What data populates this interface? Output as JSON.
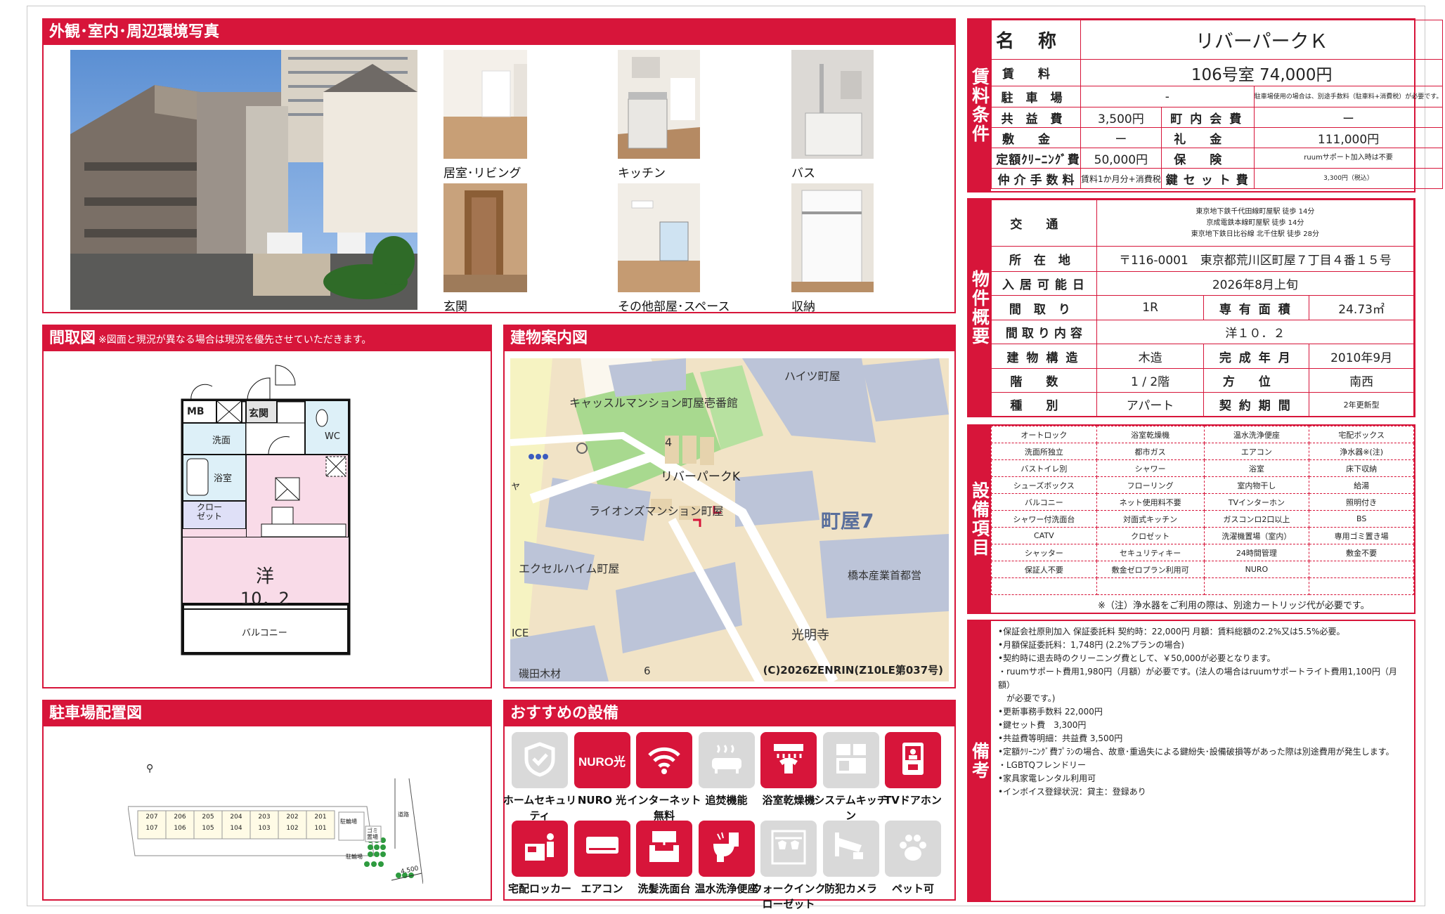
{
  "photos": {
    "title": "外観･室内･周辺環境写真",
    "captions": [
      "居室･リビング",
      "キッチン",
      "バス",
      "玄関",
      "その他部屋･スペース",
      "収納"
    ]
  },
  "floorplan": {
    "title": "間取図",
    "note": "※図面と現況が異なる場合は現況を優先させていただきます。",
    "rooms": {
      "mb": "MB",
      "entrance": "玄関",
      "wash": "洗面",
      "wc": "WC",
      "bath": "浴室",
      "closet": "クロー\nゼット",
      "main": "洋",
      "main_size": "10．2",
      "balcony": "バルコニー"
    }
  },
  "map": {
    "title": "建物案内図",
    "labels": [
      "ハイツ町屋",
      "キャッスルマンション町屋壱番館",
      "4",
      "リバーパークK",
      "ライオンズマンション町屋",
      "町屋7",
      "エクセルハイム町屋",
      "橋本産業首都営",
      "光明寺",
      "ICE",
      "磯田木材",
      "6",
      "ャ"
    ],
    "copyright": "(C)2026ZENRIN(Z10LE第037号)"
  },
  "parking": {
    "title": "駐車場配置図",
    "units_top": [
      "207",
      "206",
      "205",
      "204",
      "203",
      "202",
      "201"
    ],
    "units_bottom": [
      "107",
      "106",
      "105",
      "104",
      "103",
      "102",
      "101"
    ],
    "bike": "駐輪場",
    "bike2": "駐輪場",
    "trash": "ゴミ\n置場",
    "road": "道路",
    "width": "4.500"
  },
  "recommended": {
    "title": "おすすめの設備",
    "items": [
      {
        "label": "ホームセキュリティ",
        "on": false,
        "icon": "shield-icon"
      },
      {
        "label": "NURO 光",
        "on": true,
        "icon": "nuro-icon",
        "glyph": "NURO光"
      },
      {
        "label": "インターネット無料",
        "on": true,
        "icon": "wifi-icon"
      },
      {
        "label": "追焚機能",
        "on": false,
        "icon": "bathtub-icon"
      },
      {
        "label": "浴室乾燥機",
        "on": true,
        "icon": "bath-dryer-icon"
      },
      {
        "label": "システムキッチン",
        "on": false,
        "icon": "kitchen-icon"
      },
      {
        "label": "TVドアホン",
        "on": true,
        "icon": "tv-intercom-icon"
      },
      {
        "label": "宅配ロッカー",
        "on": true,
        "icon": "delivery-locker-icon"
      },
      {
        "label": "エアコン",
        "on": true,
        "icon": "air-conditioner-icon"
      },
      {
        "label": "洗髪洗面台",
        "on": true,
        "icon": "washbasin-icon"
      },
      {
        "label": "温水洗浄便座",
        "on": true,
        "icon": "toilet-icon"
      },
      {
        "label": "ウォークインクローゼット",
        "on": false,
        "icon": "walk-in-closet-icon"
      },
      {
        "label": "防犯カメラ",
        "on": false,
        "icon": "security-camera-icon"
      },
      {
        "label": "ペット可",
        "on": false,
        "icon": "paw-icon"
      }
    ]
  },
  "rent": {
    "side": "賃料条件",
    "name_label": "名称",
    "name": "リバーパークＫ",
    "rent_label": "賃料",
    "rent": "106号室 74,000円",
    "parking_label": "駐車場",
    "parking": "-",
    "parking_note": "駐車場使用の場合は、別途手数料（駐車料+消費税）が必要です。",
    "common_label": "共益費",
    "common": "3,500円",
    "town_label": "町内会費",
    "town": "ー",
    "deposit_label": "敷金",
    "deposit": "ー",
    "key_money_label": "礼金",
    "key_money": "111,000円",
    "cleaning_label": "定額ｸﾘｰﾆﾝｸﾞ費",
    "cleaning": "50,000円",
    "insurance_label": "保険",
    "insurance": "ruumサポート加入時は不要",
    "agency_label": "仲介手数料",
    "agency": "賃料1か月分+消費税",
    "key_exchange_label": "鍵セット費",
    "key_exchange": "3,300円（税込）"
  },
  "property": {
    "side": "物件概要",
    "access_label": "交通",
    "access": [
      "東京地下鉄千代田線町屋駅 徒歩 14分",
      "京成電鉄本線町屋駅 徒歩 14分",
      "東京地下鉄日比谷線 北千住駅 徒歩 28分"
    ],
    "address_label": "所在地",
    "address": "〒116-0001　東京都荒川区町屋７丁目４番１５号",
    "movein_label": "入居可能日",
    "movein": "2026年8月上旬",
    "layout_label": "間取り",
    "layout": "1R",
    "area_label": "専有面積",
    "area": "24.73㎡",
    "layout_detail_label": "間取り内容",
    "layout_detail": "洋１０．２",
    "structure_label": "建物構造",
    "structure": "木造",
    "built_label": "完成年月",
    "built": "2010年9月",
    "floor_label": "階数",
    "floor": "1 / 2階",
    "direction_label": "方位",
    "direction": "南西",
    "type_label": "種別",
    "type": "アパート",
    "contract_label": "契約期間",
    "contract": "2年更新型"
  },
  "equipment": {
    "side": "設備項目",
    "rows": [
      [
        "オートロック",
        "浴室乾燥機",
        "温水洗浄便座",
        "宅配ボックス"
      ],
      [
        "洗面所独立",
        "都市ガス",
        "エアコン",
        "浄水器※(注)"
      ],
      [
        "バストイレ別",
        "シャワー",
        "浴室",
        "床下収納"
      ],
      [
        "シューズボックス",
        "フローリング",
        "室内物干し",
        "給湯"
      ],
      [
        "バルコニー",
        "ネット使用料不要",
        "TVインターホン",
        "照明付き"
      ],
      [
        "シャワー付洗面台",
        "対面式キッチン",
        "ガスコンロ2口以上",
        "BS"
      ],
      [
        "CATV",
        "クロゼット",
        "洗濯機置場（室内）",
        "専用ゴミ置き場"
      ],
      [
        "シャッター",
        "セキュリティキー",
        "24時間管理",
        "敷金不要"
      ],
      [
        "保証人不要",
        "敷金ゼロプラン利用可",
        "NURO",
        ""
      ],
      [
        "",
        "",
        "",
        ""
      ]
    ],
    "footnote": "※（注）浄水器をご利用の際は、別途カートリッジ代が必要です。"
  },
  "remarks": {
    "side": "備考",
    "lines": [
      "•保証会社原則加入 保証委託料 契約時：22,000円 月額：賃料総額の2.2%又は5.5%必要。",
      "•月額保証委託料：1,748円 (2.2%プランの場合)",
      "•契約時に退去時のクリーニング費として、￥50,000が必要となります。",
      "・ruumサポート費用1,980円（月額）が必要です。(法人の場合はruumサポートライト費用1,100円（月額）",
      "　が必要です。)",
      "•更新事務手数料 22,000円",
      "•鍵セット費　3,300円",
      "•共益費等明細：共益費 3,500円",
      "•定額ｸﾘｰﾆﾝｸﾞ費ﾌﾟﾗﾝの場合、故意･重過失による鍵紛失･設備破損等があった際は別途費用が発生します。",
      "・LGBTQフレンドリー",
      "•家具家電レンタル利用可",
      "•インボイス登録状況：貸主：登録あり"
    ]
  }
}
